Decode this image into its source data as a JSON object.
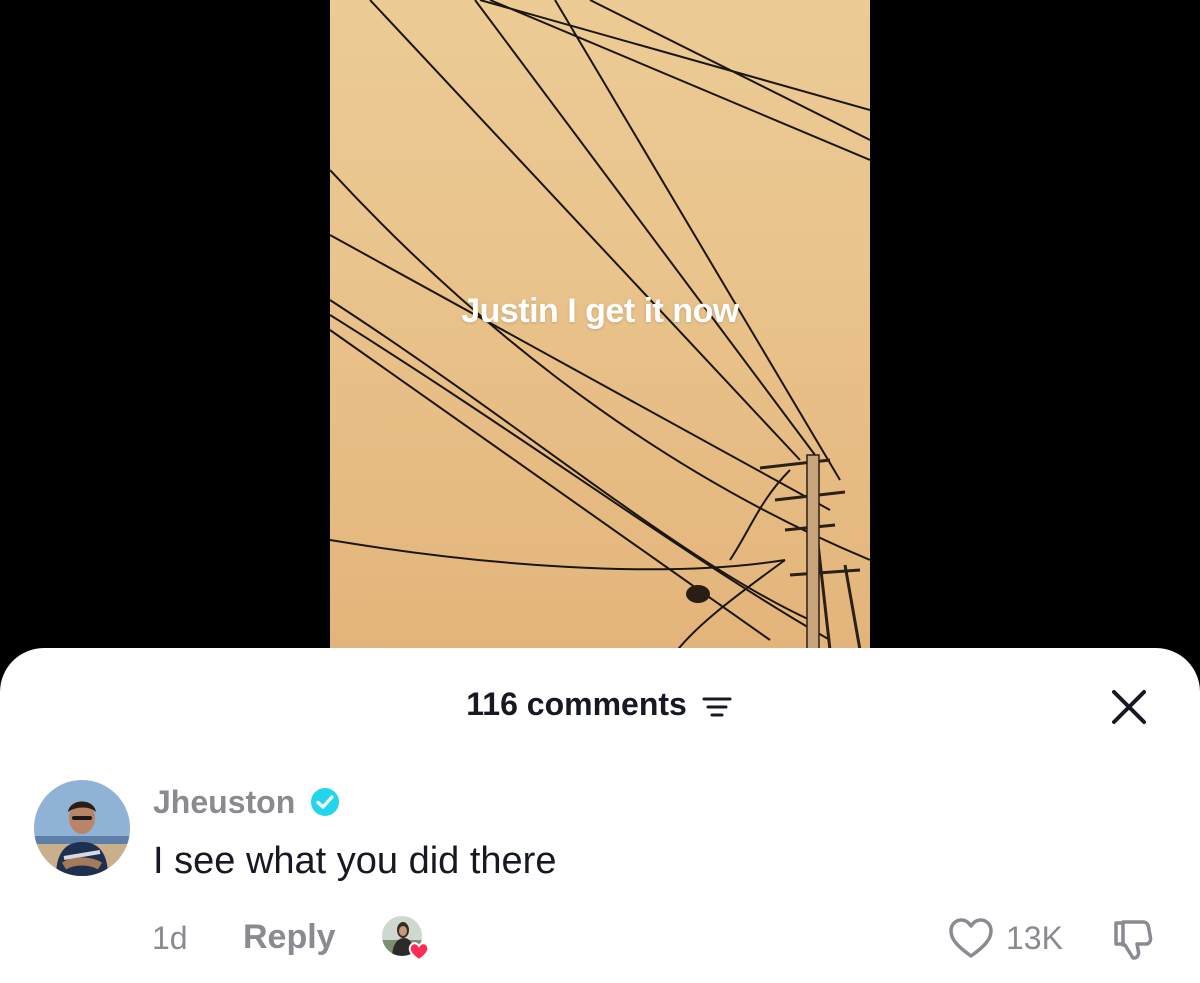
{
  "video": {
    "caption": "Justin I get it now"
  },
  "comments_panel": {
    "count_label": "116 comments",
    "sort_icon": "sort-lines-icon",
    "close_icon": "close-icon"
  },
  "comment": {
    "username": "Jheuston",
    "verified": true,
    "text": "I see what you did there",
    "time": "1d",
    "reply_label": "Reply",
    "liked_by_creator": true,
    "like_count": "13K",
    "colors": {
      "verified_badge": "#20d5ec",
      "heart": "#fe2c55",
      "muted_text": "#8a8b91",
      "primary_text": "#161823"
    }
  }
}
